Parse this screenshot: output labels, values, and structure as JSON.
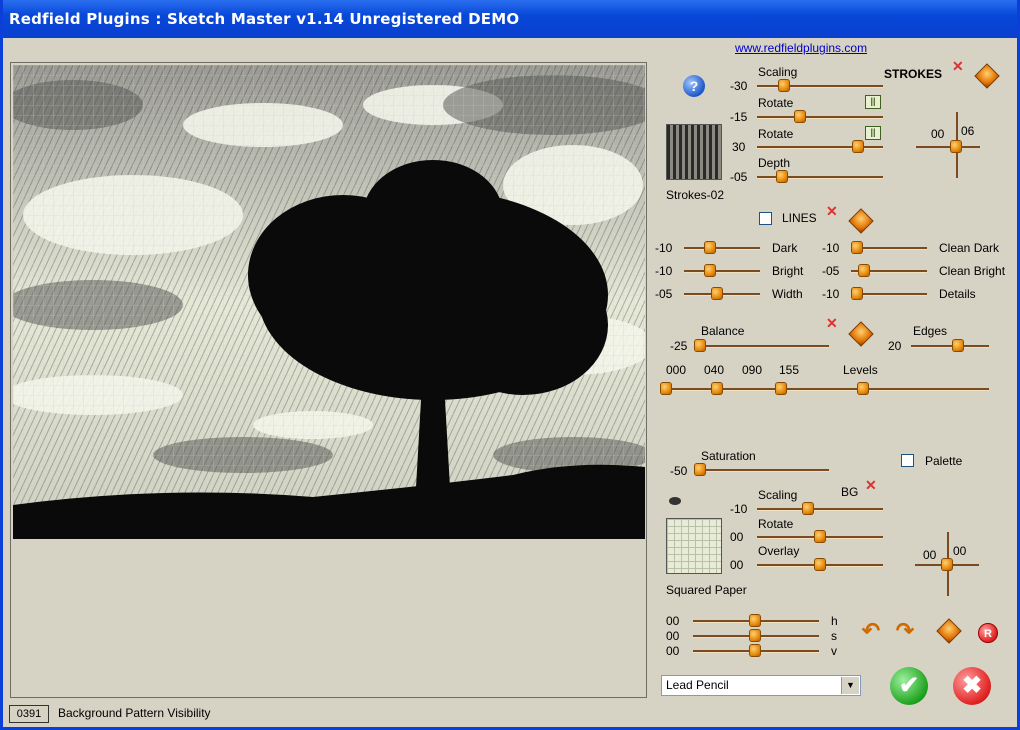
{
  "window": {
    "title": "Redfield Plugins : Sketch Master v1.14   Unregistered  DEMO"
  },
  "link": "www.redfieldplugins.com",
  "status": {
    "number": "0391",
    "text": "Background Pattern Visibility"
  },
  "strokes": {
    "header": "STROKES",
    "preset_name": "Strokes-02",
    "sliders": [
      {
        "label": "Scaling",
        "value": "-30"
      },
      {
        "label": "Rotate",
        "value": "-15"
      },
      {
        "label": "Rotate",
        "value": "30"
      },
      {
        "label": "Depth",
        "value": "-05"
      }
    ],
    "cross_values": [
      "00",
      "06"
    ]
  },
  "lines": {
    "header": "LINES",
    "left": [
      {
        "label": "Dark",
        "value": "-10"
      },
      {
        "label": "Bright",
        "value": "-10"
      },
      {
        "label": "Width",
        "value": "-05"
      }
    ],
    "right": [
      {
        "label": "Clean Dark",
        "value": "-10"
      },
      {
        "label": "Clean Bright",
        "value": "-05"
      },
      {
        "label": "Details",
        "value": "-10"
      }
    ]
  },
  "balance": {
    "label": "Balance",
    "value": "-25",
    "edges_label": "Edges",
    "edges_value": "20"
  },
  "levels": {
    "label": "Levels",
    "values": [
      "000",
      "040",
      "090",
      "155"
    ]
  },
  "saturation": {
    "label": "Saturation",
    "value": "-50",
    "palette_label": "Palette"
  },
  "background": {
    "bg_label": "BG",
    "preset_name": "Squared Paper",
    "sliders": [
      {
        "label": "Scaling",
        "value": "-10"
      },
      {
        "label": "Rotate",
        "value": "00"
      },
      {
        "label": "Overlay",
        "value": "00"
      }
    ],
    "cross_values": [
      "00",
      "00"
    ]
  },
  "hsv": [
    {
      "label": "h",
      "value": "00"
    },
    {
      "label": "s",
      "value": "00"
    },
    {
      "label": "v",
      "value": "00"
    }
  ],
  "preset_select": {
    "value": "Lead Pencil"
  },
  "help_glyph": "?",
  "reset_glyph": "R",
  "icons": [
    "help-icon",
    "remove-x-icon",
    "randomize-diamond-icon",
    "ok-check-icon",
    "cancel-x-icon",
    "undo-arrow-icon",
    "redo-arrow-icon",
    "eye-icon"
  ]
}
